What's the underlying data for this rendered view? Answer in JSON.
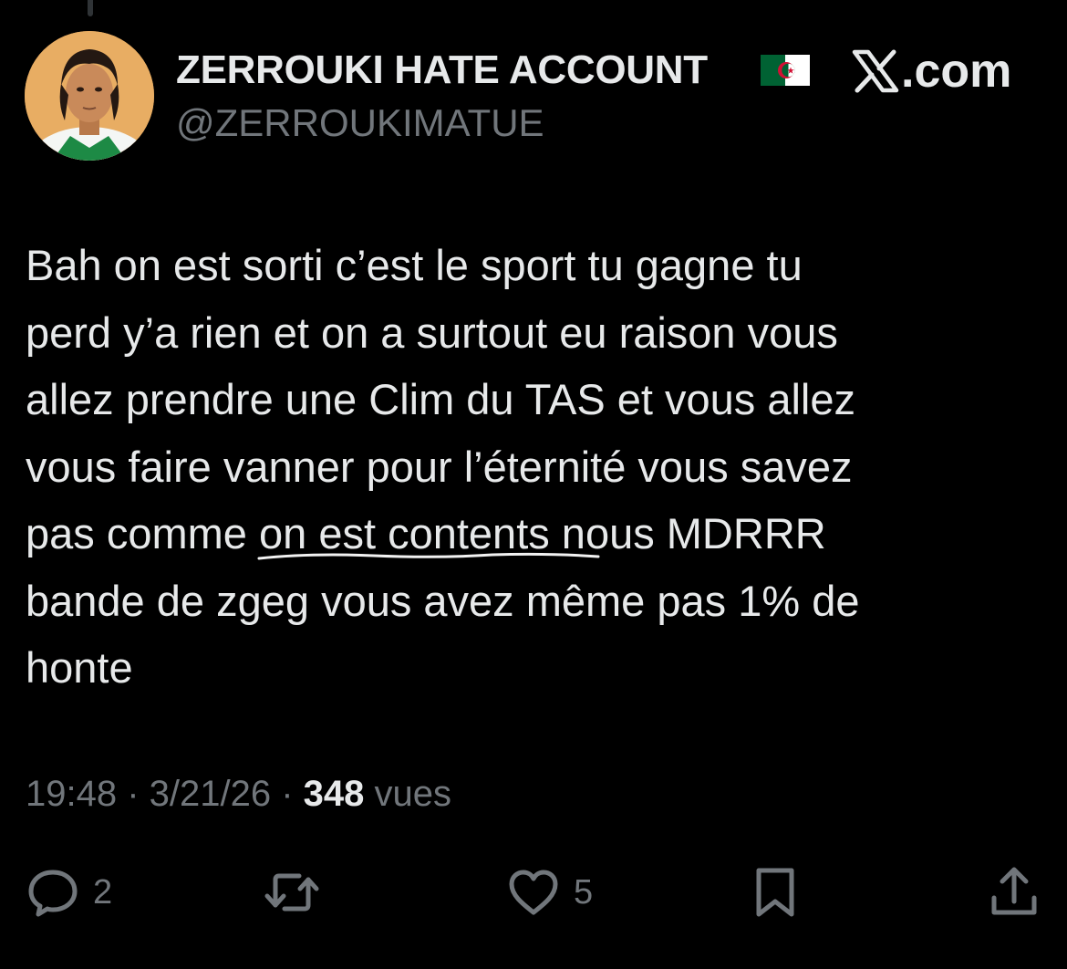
{
  "brand": {
    "domain": ".com"
  },
  "author": {
    "display_name": "ZERROUKI HATE ACCOUNT",
    "handle": "@ZERROUKIMATUE"
  },
  "tweet": {
    "lines": [
      "Bah on est sorti c’est le sport tu gagne tu",
      "perd y’a rien et on a surtout eu raison vous",
      "allez prendre une Clim du TAS et vous allez",
      "vous faire vanner pour l’éternité vous savez"
    ],
    "line5_before": "pas comme ",
    "line5_underlined": "on est contents",
    "line5_after": " nous MDRRR",
    "line6": "bande de zgeg vous avez même pas 1% de",
    "line7": "honte"
  },
  "meta": {
    "time": "19:48",
    "separator": " · ",
    "date": "3/21/26",
    "views_count": "348",
    "views_label": " vues"
  },
  "actions": {
    "reply": {
      "icon": "reply-icon",
      "count": "2"
    },
    "repost": {
      "icon": "repost-icon",
      "count": ""
    },
    "like": {
      "icon": "heart-icon",
      "count": "5"
    },
    "bookmark": {
      "icon": "bookmark-icon",
      "count": ""
    },
    "share": {
      "icon": "share-icon",
      "count": ""
    }
  },
  "colors": {
    "background": "#000000",
    "text_primary": "#e7e9ea",
    "text_secondary": "#71767b",
    "flag_green": "#006233",
    "flag_white": "#ffffff",
    "flag_red": "#d21034"
  }
}
